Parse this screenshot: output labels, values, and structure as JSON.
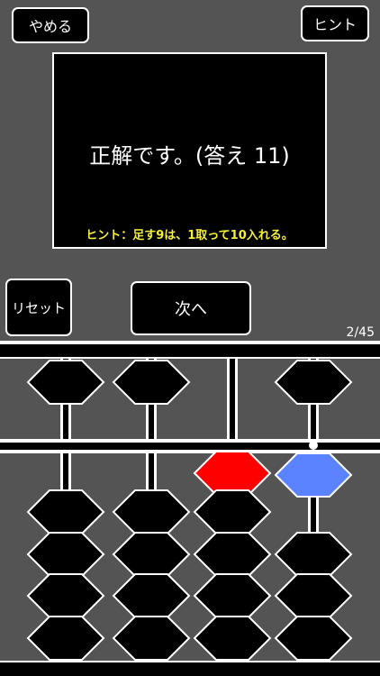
{
  "buttons": {
    "quit": "やめる",
    "hint": "ヒント",
    "reset": "リセット",
    "next": "次へ"
  },
  "message": {
    "result": "正解です。(答え 11)",
    "hint": "ヒント：足す9は、1取って10入れる。"
  },
  "progress": "2/45",
  "colors": {
    "background": "#545454",
    "bead": "#000000",
    "active_red": "#ff0000",
    "active_blue": "#5b83ff",
    "hint_text": "#f5ef3a"
  },
  "abacus": {
    "rods": [
      {
        "heaven_active": false,
        "earth_active_count": 0,
        "earth_highlight": null
      },
      {
        "heaven_active": false,
        "earth_active_count": 0,
        "earth_highlight": null
      },
      {
        "heaven_active": true,
        "heaven_color": "red",
        "earth_active_count": 0,
        "earth_highlight": null
      },
      {
        "heaven_active": false,
        "earth_active_count": 1,
        "earth_highlight": "blue",
        "unit_dot": true
      }
    ]
  }
}
